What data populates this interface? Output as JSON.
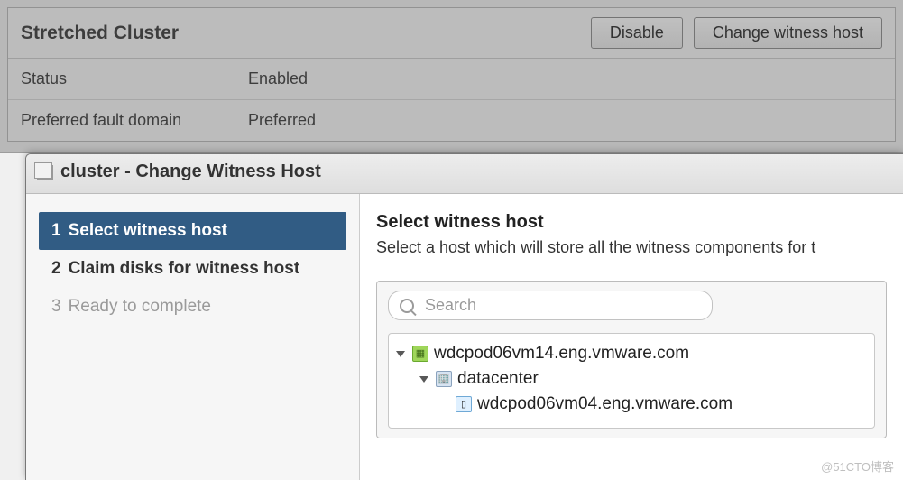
{
  "panel": {
    "title": "Stretched Cluster",
    "buttons": {
      "disable": "Disable",
      "change_witness": "Change witness host"
    },
    "rows": {
      "status_label": "Status",
      "status_value": "Enabled",
      "pfd_label": "Preferred fault domain",
      "pfd_value": "Preferred"
    }
  },
  "dialog": {
    "title": "cluster - Change Witness Host",
    "steps": [
      {
        "num": "1",
        "label": "Select witness host"
      },
      {
        "num": "2",
        "label": "Claim disks for witness host"
      },
      {
        "num": "3",
        "label": "Ready to complete"
      }
    ],
    "content": {
      "heading": "Select witness host",
      "desc": "Select a host which will store all the witness components for t",
      "search_placeholder": "Search",
      "tree": {
        "vcenter": "wdcpod06vm14.eng.vmware.com",
        "datacenter": "datacenter",
        "host": "wdcpod06vm04.eng.vmware.com"
      }
    }
  },
  "watermark": "@51CTO博客"
}
